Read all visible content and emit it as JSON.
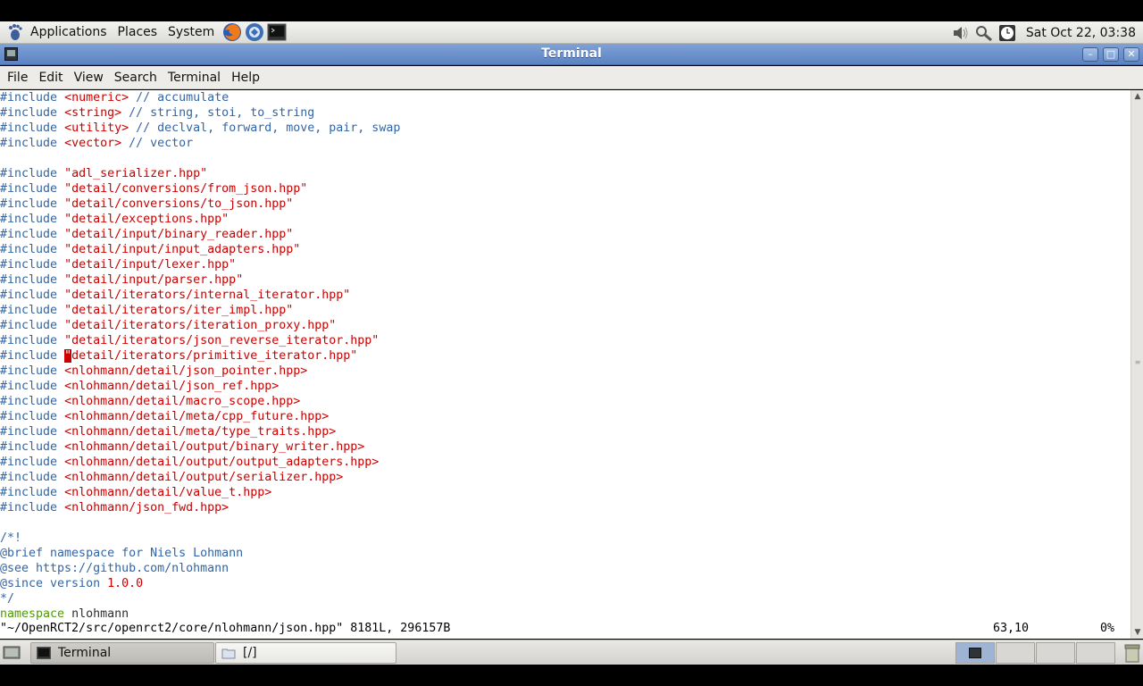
{
  "top_panel": {
    "menus": [
      "Applications",
      "Places",
      "System"
    ],
    "clock": "Sat Oct 22, 03:38"
  },
  "window": {
    "title": "Terminal"
  },
  "menubar": [
    "File",
    "Edit",
    "View",
    "Search",
    "Terminal",
    "Help"
  ],
  "editor": {
    "lines": [
      [
        [
          "kw",
          "#include "
        ],
        [
          "sys",
          "<numeric>"
        ],
        [
          "cmt",
          " // accumulate"
        ]
      ],
      [
        [
          "kw",
          "#include "
        ],
        [
          "sys",
          "<string>"
        ],
        [
          "cmt",
          " // string, stoi, to_string"
        ]
      ],
      [
        [
          "kw",
          "#include "
        ],
        [
          "sys",
          "<utility>"
        ],
        [
          "cmt",
          " // declval, forward, move, pair, swap"
        ]
      ],
      [
        [
          "kw",
          "#include "
        ],
        [
          "sys",
          "<vector>"
        ],
        [
          "cmt",
          " // vector"
        ]
      ],
      [],
      [
        [
          "kw",
          "#include "
        ],
        [
          "str",
          "\"adl_serializer.hpp\""
        ]
      ],
      [
        [
          "kw",
          "#include "
        ],
        [
          "str",
          "\"detail/conversions/from_json.hpp\""
        ]
      ],
      [
        [
          "kw",
          "#include "
        ],
        [
          "str",
          "\"detail/conversions/to_json.hpp\""
        ]
      ],
      [
        [
          "kw",
          "#include "
        ],
        [
          "str",
          "\"detail/exceptions.hpp\""
        ]
      ],
      [
        [
          "kw",
          "#include "
        ],
        [
          "str",
          "\"detail/input/binary_reader.hpp\""
        ]
      ],
      [
        [
          "kw",
          "#include "
        ],
        [
          "str",
          "\"detail/input/input_adapters.hpp\""
        ]
      ],
      [
        [
          "kw",
          "#include "
        ],
        [
          "str",
          "\"detail/input/lexer.hpp\""
        ]
      ],
      [
        [
          "kw",
          "#include "
        ],
        [
          "str",
          "\"detail/input/parser.hpp\""
        ]
      ],
      [
        [
          "kw",
          "#include "
        ],
        [
          "str",
          "\"detail/iterators/internal_iterator.hpp\""
        ]
      ],
      [
        [
          "kw",
          "#include "
        ],
        [
          "str",
          "\"detail/iterators/iter_impl.hpp\""
        ]
      ],
      [
        [
          "kw",
          "#include "
        ],
        [
          "str",
          "\"detail/iterators/iteration_proxy.hpp\""
        ]
      ],
      [
        [
          "kw",
          "#include "
        ],
        [
          "str",
          "\"detail/iterators/json_reverse_iterator.hpp\""
        ]
      ],
      [
        [
          "kw",
          "#include "
        ],
        [
          "cursor",
          "\""
        ],
        [
          "str",
          "detail/iterators/primitive_iterator.hpp\""
        ]
      ],
      [
        [
          "kw",
          "#include "
        ],
        [
          "sys",
          "<nlohmann/detail/json_pointer.hpp>"
        ]
      ],
      [
        [
          "kw",
          "#include "
        ],
        [
          "sys",
          "<nlohmann/detail/json_ref.hpp>"
        ]
      ],
      [
        [
          "kw",
          "#include "
        ],
        [
          "sys",
          "<nlohmann/detail/macro_scope.hpp>"
        ]
      ],
      [
        [
          "kw",
          "#include "
        ],
        [
          "sys",
          "<nlohmann/detail/meta/cpp_future.hpp>"
        ]
      ],
      [
        [
          "kw",
          "#include "
        ],
        [
          "sys",
          "<nlohmann/detail/meta/type_traits.hpp>"
        ]
      ],
      [
        [
          "kw",
          "#include "
        ],
        [
          "sys",
          "<nlohmann/detail/output/binary_writer.hpp>"
        ]
      ],
      [
        [
          "kw",
          "#include "
        ],
        [
          "sys",
          "<nlohmann/detail/output/output_adapters.hpp>"
        ]
      ],
      [
        [
          "kw",
          "#include "
        ],
        [
          "sys",
          "<nlohmann/detail/output/serializer.hpp>"
        ]
      ],
      [
        [
          "kw",
          "#include "
        ],
        [
          "sys",
          "<nlohmann/detail/value_t.hpp>"
        ]
      ],
      [
        [
          "kw",
          "#include "
        ],
        [
          "sys",
          "<nlohmann/json_fwd.hpp>"
        ]
      ],
      [],
      [
        [
          "cmt",
          "/*!"
        ]
      ],
      [
        [
          "cmt",
          "@brief namespace for Niels Lohmann"
        ]
      ],
      [
        [
          "cmt",
          "@see https://github.com/nlohmann"
        ]
      ],
      [
        [
          "cmt",
          "@since version "
        ],
        [
          "num",
          "1.0.0"
        ]
      ],
      [
        [
          "cmt",
          "*/"
        ]
      ],
      [
        [
          "ns",
          "namespace"
        ],
        [
          "plain",
          " nlohmann"
        ]
      ]
    ],
    "status_file": "\"~/OpenRCT2/src/openrct2/core/nlohmann/json.hpp\" 8181L, 296157B",
    "status_position": "63,10",
    "status_percent": "0%"
  },
  "taskbar": {
    "tasks": [
      {
        "label": "Terminal",
        "icon": "terminal-icon",
        "active": true
      },
      {
        "label": "[/]",
        "icon": "folder-icon",
        "active": false
      }
    ]
  },
  "colors": {
    "titlebar": "#5b83c2",
    "keyword": "#3465a4",
    "string": "#cc0000",
    "namespace": "#4e9a06"
  }
}
